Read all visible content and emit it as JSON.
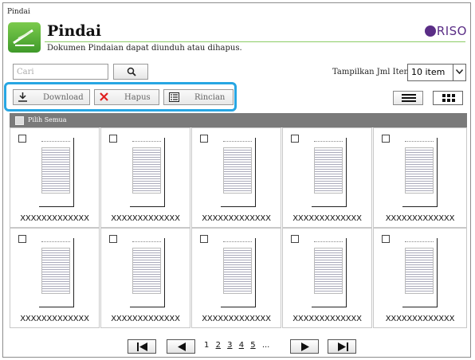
{
  "breadcrumb": "Pindai",
  "header": {
    "title": "Pindai",
    "description": "Dokumen Pindaian dapat diunduh atau dihapus.",
    "logo_text": "RISO",
    "brand_color": "#5a2d86",
    "accent_color": "#27a6e3"
  },
  "search": {
    "placeholder": "Cari",
    "button_icon": "search-icon"
  },
  "display_count": {
    "label": "Tampilkan Jml Item:",
    "selected": "10 item"
  },
  "actions": {
    "download": "Download",
    "delete": "Hapus",
    "details": "Rincian"
  },
  "select_all": "Pilih Semua",
  "items": [
    {
      "name": "XXXXXXXXXXXXX",
      "checked": false
    },
    {
      "name": "XXXXXXXXXXXXX",
      "checked": false
    },
    {
      "name": "XXXXXXXXXXXXX",
      "checked": false
    },
    {
      "name": "XXXXXXXXXXXXX",
      "checked": false
    },
    {
      "name": "XXXXXXXXXXXXX",
      "checked": false
    },
    {
      "name": "XXXXXXXXXXXXX",
      "checked": false
    },
    {
      "name": "XXXXXXXXXXXXX",
      "checked": false
    },
    {
      "name": "XXXXXXXXXXXXX",
      "checked": false
    },
    {
      "name": "XXXXXXXXXXXXX",
      "checked": false
    },
    {
      "name": "XXXXXXXXXXXXX",
      "checked": false
    }
  ],
  "pagination": {
    "current": "1",
    "pages": [
      "2",
      "3",
      "4",
      "5"
    ],
    "more": "..."
  }
}
